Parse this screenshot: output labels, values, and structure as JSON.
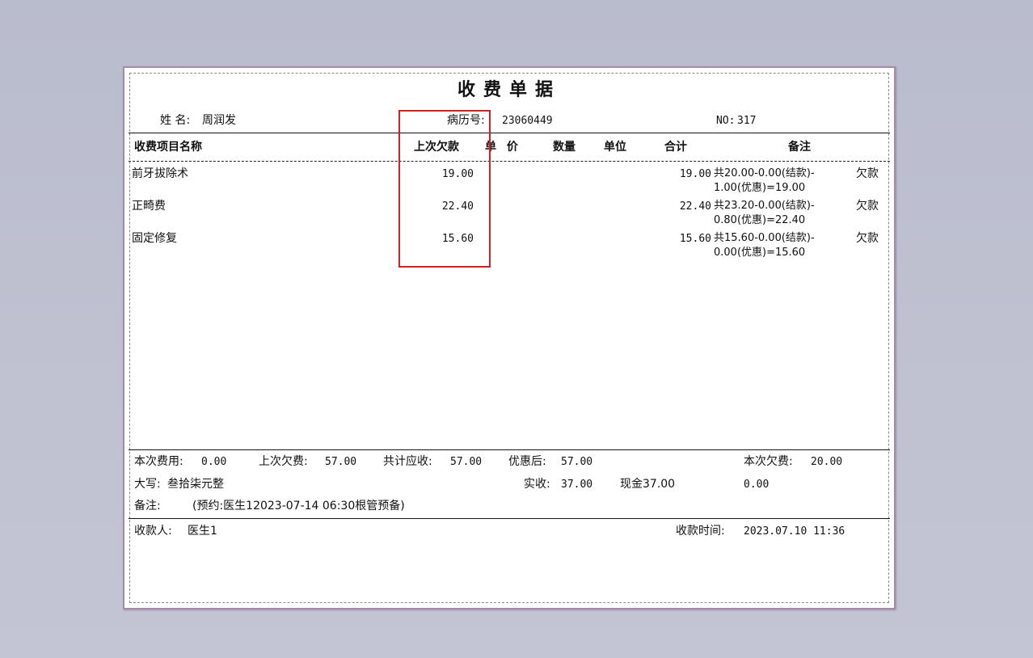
{
  "receipt": {
    "title": "收费单据",
    "patient_name_label": "姓 名:",
    "patient_name": "周润发",
    "record_no_label": "病历号:",
    "record_no": "23060449",
    "no_label": "NO:",
    "no_value": "317"
  },
  "table": {
    "headers": {
      "item_name": "收费项目名称",
      "prev_debt": "上次欠款",
      "unit_price": "单  价",
      "quantity": "数量",
      "unit": "单位",
      "total": "合计",
      "remarks": "备注"
    },
    "rows": [
      {
        "name": "前牙拔除术",
        "prev_debt": "19.00",
        "total": "19.00",
        "note_line1": "共20.00-0.00(结款)-",
        "note_line2": "1.00(优惠)=19.00",
        "status": "欠款"
      },
      {
        "name": "正畸费",
        "prev_debt": "22.40",
        "total": "22.40",
        "note_line1": "共23.20-0.00(结款)-",
        "note_line2": "0.80(优惠)=22.40",
        "status": "欠款"
      },
      {
        "name": "固定修复",
        "prev_debt": "15.60",
        "total": "15.60",
        "note_line1": "共15.60-0.00(结款)-",
        "note_line2": "0.00(优惠)=15.60",
        "status": "欠款"
      }
    ]
  },
  "summary": {
    "current_fee_label": "本次费用:",
    "current_fee": "0.00",
    "prev_debt_label": "上次欠费:",
    "prev_debt": "57.00",
    "total_due_label": "共计应收:",
    "total_due": "57.00",
    "after_discount_label": "优惠后:",
    "after_discount": "57.00",
    "current_debt_label": "本次欠费:",
    "current_debt": "20.00",
    "amount_words_label": "大写:",
    "amount_words": "叁拾柒元整",
    "received_label": "实收:",
    "received": "37.00",
    "cash": "现金37.00",
    "extra_value": "0.00",
    "remarks_label": "备注:",
    "remarks": "(预约:医生12023-07-14 06:30根管预备)"
  },
  "footer": {
    "cashier_label": "收款人:",
    "cashier": "医生1",
    "time_label": "收款时间:",
    "time": "2023.07.10 11:36"
  },
  "colors": {
    "highlight_border": "#d42020",
    "sheet_border": "#a78aa8",
    "background": "#bcbfcf"
  }
}
